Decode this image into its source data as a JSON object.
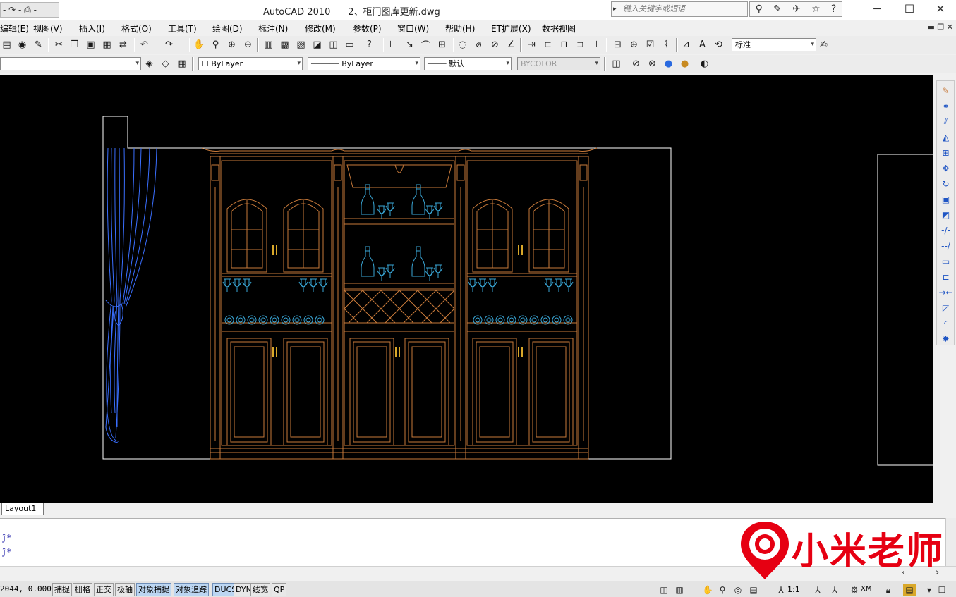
{
  "app": {
    "title": "AutoCAD 2010",
    "document": "2、柜门图库更新.dwg"
  },
  "quick_access": {
    "label": "- ↷ - ⎙ -"
  },
  "search": {
    "placeholder": "键入关键字或短语"
  },
  "window_controls": {
    "minimize": "─",
    "maximize": "☐",
    "close": "✕"
  },
  "menubar": {
    "items": [
      "编辑(E)",
      "视图(V)",
      "插入(I)",
      "格式(O)",
      "工具(T)",
      "绘图(D)",
      "标注(N)",
      "修改(M)",
      "参数(P)",
      "窗口(W)",
      "帮助(H)",
      "ET扩展(X)",
      "数据视图"
    ],
    "mdi_controls": "▬ ❐ ✕"
  },
  "toolbars": {
    "dimstyle_combo": "标准",
    "layer_combo": "",
    "color_combo": "ByLayer",
    "linetype_combo": "ByLayer",
    "lineweight_combo": "默认",
    "plotstyle_combo": "BYCOLOR"
  },
  "layout_tab": {
    "label": "Layout1"
  },
  "command_lines": [
    "ĵ*",
    "ĵ*"
  ],
  "statusbar": {
    "coords": "2044, 0.0000",
    "buttons": [
      {
        "label": "捕捉",
        "on": false
      },
      {
        "label": "栅格",
        "on": false
      },
      {
        "label": "正交",
        "on": false
      },
      {
        "label": "极轴",
        "on": false
      },
      {
        "label": "对象捕捉",
        "on": true
      },
      {
        "label": "对象追踪",
        "on": true
      },
      {
        "label": "DUCS",
        "on": true
      },
      {
        "label": "DYN",
        "on": false
      },
      {
        "label": "线宽",
        "on": false
      },
      {
        "label": "QP",
        "on": false
      }
    ],
    "annotation_scale": "1:1",
    "workspace": "XM"
  },
  "watermark": {
    "text": "小米老师"
  },
  "colors": {
    "canvas": "#000000",
    "furniture": "#c87a3a",
    "curtain": "#3a6fff",
    "glass": "#3aa8d8",
    "hardware": "#d9a82a",
    "border": "#ffffff",
    "logo": "#e60012"
  }
}
